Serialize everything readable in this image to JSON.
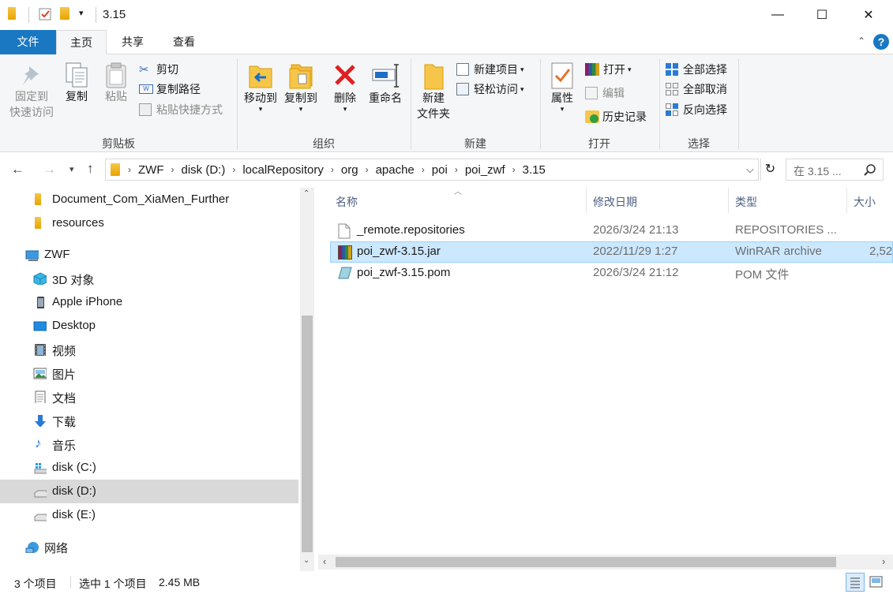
{
  "window": {
    "title": "3.15",
    "minimize": "—",
    "maximize": "☐",
    "close": "✕"
  },
  "ribbon_tabs": {
    "file": "文件",
    "home": "主页",
    "share": "共享",
    "view": "查看"
  },
  "ribbon": {
    "clipboard": {
      "pin_line1": "固定到",
      "pin_line2": "快速访问",
      "copy": "复制",
      "paste": "粘贴",
      "cut": "剪切",
      "copy_path": "复制路径",
      "paste_shortcut": "粘贴快捷方式",
      "group": "剪贴板"
    },
    "organize": {
      "move_to": "移动到",
      "copy_to": "复制到",
      "delete": "删除",
      "rename": "重命名",
      "group": "组织"
    },
    "new": {
      "new_folder_line1": "新建",
      "new_folder_line2": "文件夹",
      "new_item": "新建项目",
      "easy_access": "轻松访问",
      "group": "新建"
    },
    "open": {
      "properties": "属性",
      "open": "打开",
      "edit": "编辑",
      "history": "历史记录",
      "group": "打开"
    },
    "select": {
      "select_all": "全部选择",
      "select_none": "全部取消",
      "invert": "反向选择",
      "group": "选择"
    }
  },
  "address": {
    "crumbs": [
      "ZWF",
      "disk (D:)",
      "localRepository",
      "org",
      "apache",
      "poi",
      "poi_zwf",
      "3.15"
    ],
    "search_placeholder": "在 3.15 ..."
  },
  "nav": {
    "items": [
      "Document_Com_XiaMen_Further",
      "resources",
      "ZWF",
      "3D 对象",
      "Apple iPhone",
      "Desktop",
      "视频",
      "图片",
      "文档",
      "下载",
      "音乐",
      "disk (C:)",
      "disk (D:)",
      "disk (E:)",
      "网络"
    ]
  },
  "columns": {
    "name": "名称",
    "date": "修改日期",
    "type": "类型",
    "size": "大小"
  },
  "files": [
    {
      "name": "_remote.repositories",
      "date": "2026/3/24 21:13",
      "type": "REPOSITORIES ...",
      "size": ""
    },
    {
      "name": "poi_zwf-3.15.jar",
      "date": "2022/11/29 1:27",
      "type": "WinRAR archive",
      "size": "2,52"
    },
    {
      "name": "poi_zwf-3.15.pom",
      "date": "2026/3/24 21:12",
      "type": "POM 文件",
      "size": ""
    }
  ],
  "status": {
    "count": "3 个项目",
    "selected": "选中 1 个项目",
    "size": "2.45 MB"
  },
  "colors": {
    "accent": "#1a78c2",
    "selection": "#cce8ff",
    "nav_selected": "#d9d9d9"
  }
}
